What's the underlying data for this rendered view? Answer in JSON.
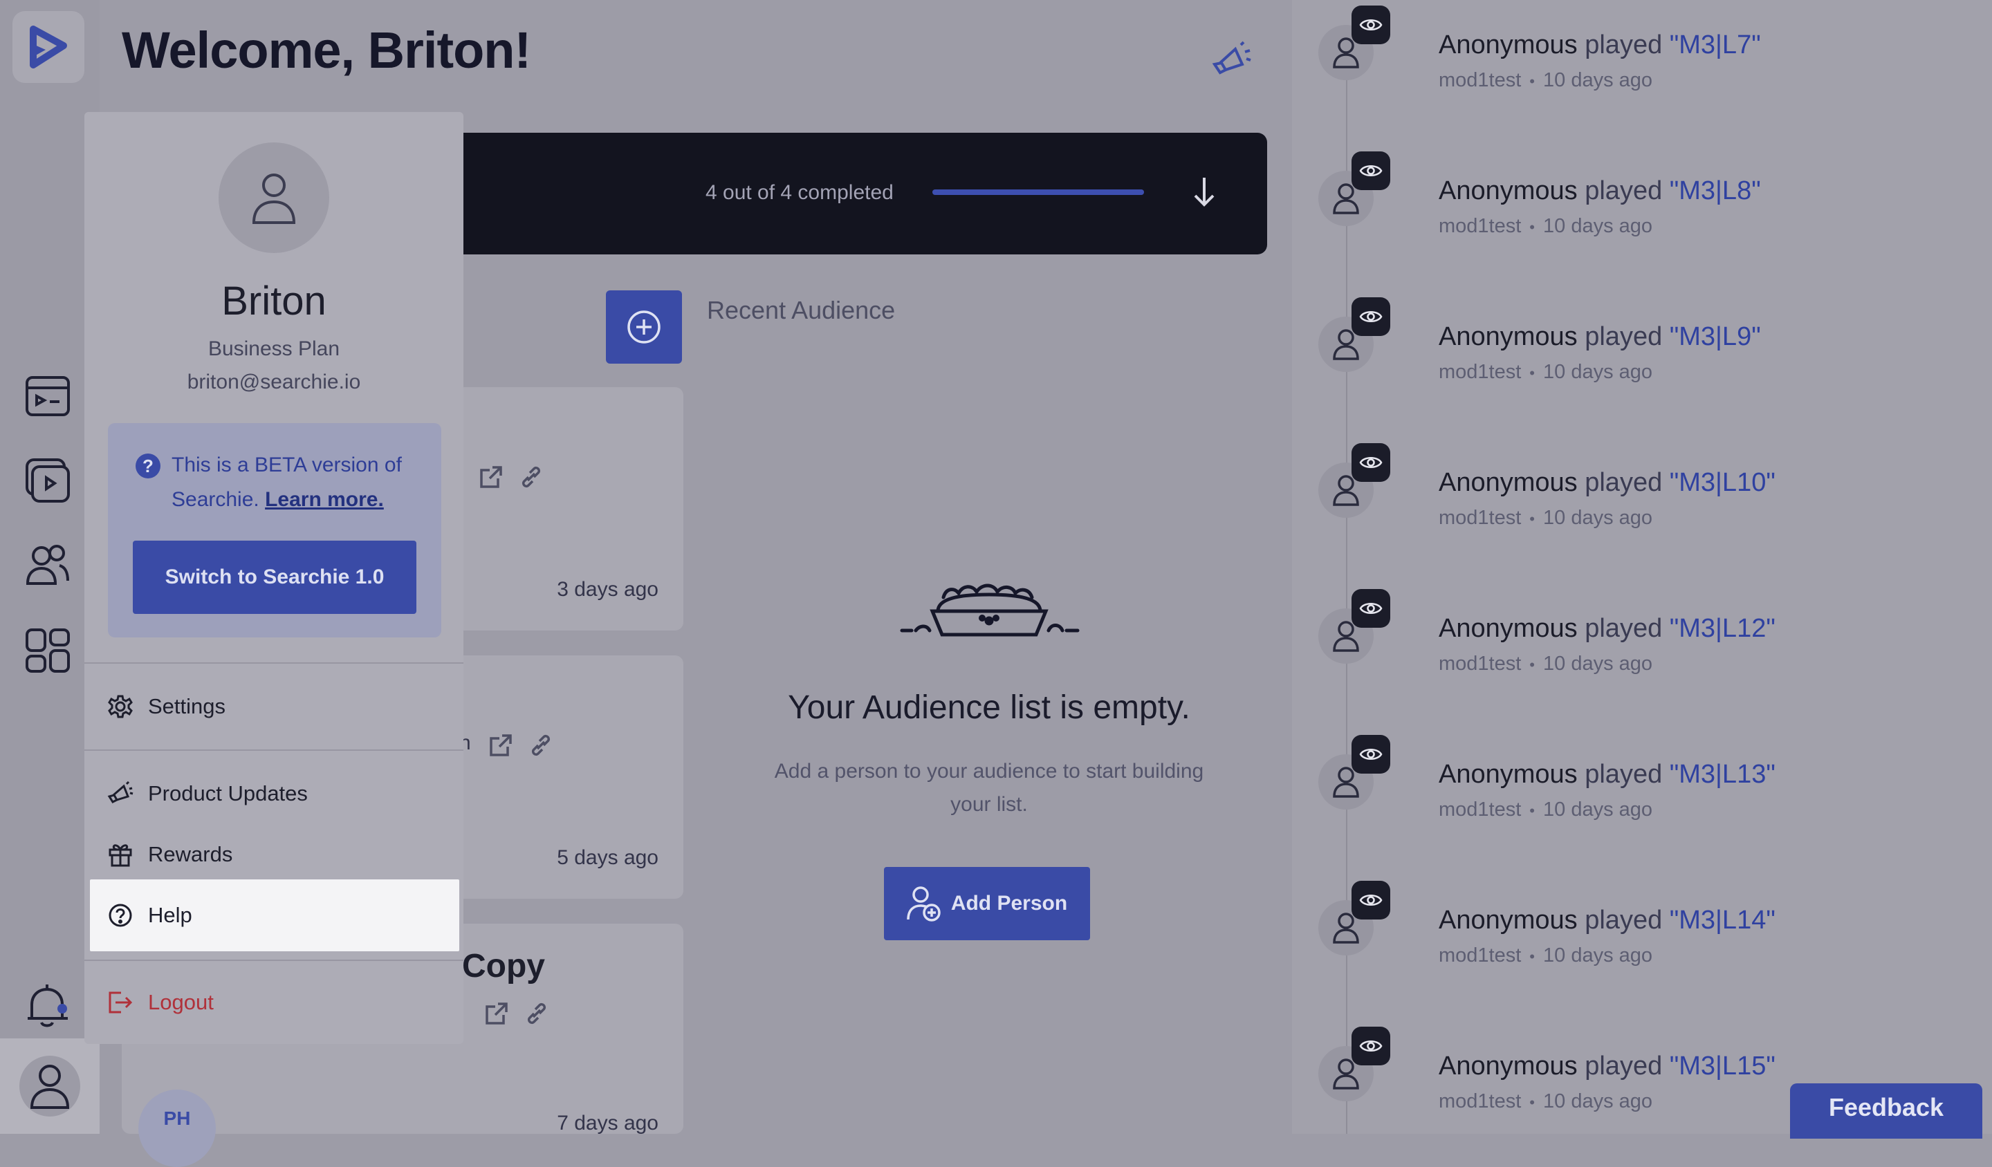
{
  "header": {
    "welcome": "Welcome, Briton!"
  },
  "progress": {
    "text": "4 out of 4 completed",
    "completed": 4,
    "total": 4
  },
  "cards": [
    {
      "time": "3 days ago"
    },
    {
      "time": "5 days ago",
      "title_fragment": "n"
    },
    {
      "time": "7 days ago",
      "title_fragment": "Copy",
      "initials": "PH"
    }
  ],
  "audience": {
    "title": "Recent Audience",
    "empty_title": "Your Audience list is empty.",
    "empty_sub": "Add a person to your audience to start building your list.",
    "add_person": "Add Person"
  },
  "menu": {
    "name": "Briton",
    "plan": "Business Plan",
    "email": "briton@searchie.io",
    "beta_text": "This is a BETA version of Searchie.",
    "beta_link": "Learn more.",
    "switch_label": "Switch to Searchie 1.0",
    "items": {
      "settings": "Settings",
      "product_updates": "Product Updates",
      "rewards": "Rewards",
      "help": "Help",
      "logout": "Logout"
    }
  },
  "feed": [
    {
      "who": "Anonymous",
      "verb": "played",
      "track": "\"M3|L7\"",
      "user": "mod1test",
      "time": "10 days ago"
    },
    {
      "who": "Anonymous",
      "verb": "played",
      "track": "\"M3|L8\"",
      "user": "mod1test",
      "time": "10 days ago"
    },
    {
      "who": "Anonymous",
      "verb": "played",
      "track": "\"M3|L9\"",
      "user": "mod1test",
      "time": "10 days ago"
    },
    {
      "who": "Anonymous",
      "verb": "played",
      "track": "\"M3|L10\"",
      "user": "mod1test",
      "time": "10 days ago"
    },
    {
      "who": "Anonymous",
      "verb": "played",
      "track": "\"M3|L12\"",
      "user": "mod1test",
      "time": "10 days ago"
    },
    {
      "who": "Anonymous",
      "verb": "played",
      "track": "\"M3|L13\"",
      "user": "mod1test",
      "time": "10 days ago"
    },
    {
      "who": "Anonymous",
      "verb": "played",
      "track": "\"M3|L14\"",
      "user": "mod1test",
      "time": "10 days ago"
    },
    {
      "who": "Anonymous",
      "verb": "played",
      "track": "\"M3|L15\"",
      "user": "mod1test",
      "time": "10 days ago"
    }
  ],
  "feed_separator": "•",
  "feedback": "Feedback",
  "icons": {
    "logo": "play-logo-icon",
    "nav1": "playlist-icon",
    "nav2": "video-library-icon",
    "nav3": "audience-icon",
    "nav4": "apps-grid-icon",
    "bell": "bell-icon",
    "user": "user-icon",
    "megaphone": "megaphone-icon",
    "eye": "eye-icon"
  },
  "colors": {
    "accent": "#3a4ba6",
    "dark": "#13141f",
    "logout": "#b0313a",
    "link": "#2f41a0"
  }
}
